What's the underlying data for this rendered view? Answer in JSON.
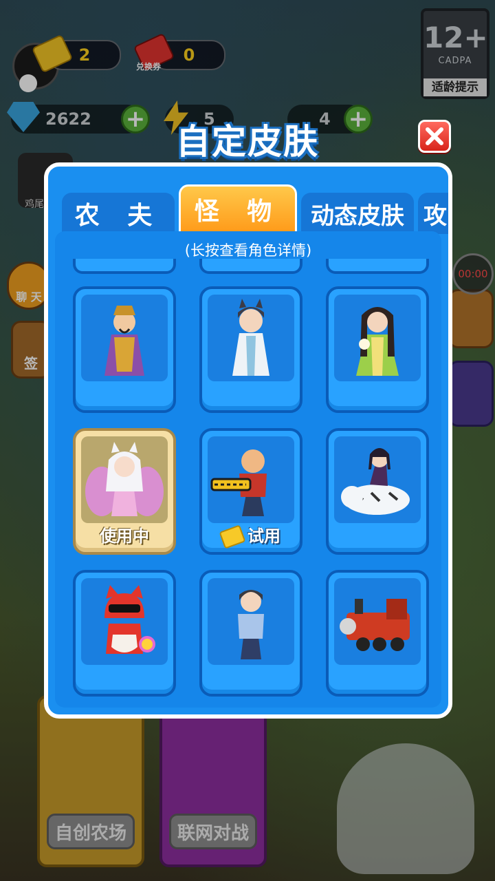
{
  "header": {
    "voucher_gold": {
      "count": "2"
    },
    "voucher_red": {
      "count": "0",
      "label": "兑换券"
    },
    "gems": "2622",
    "energy": "5",
    "potion": "4",
    "side_label_chicken": "鸡尾",
    "side_label_chat": "聊 天",
    "side_label_sign": "签"
  },
  "age_rating": {
    "age": "12+",
    "org": "CADPA",
    "tip": "适龄提示"
  },
  "timer": "00:00",
  "bottom_cards": {
    "create_farm": "自创农场",
    "online_battle": "联网对战"
  },
  "dialog": {
    "title": "自定皮肤",
    "hint": "(长按查看角色详情)",
    "tabs": [
      {
        "label": "农 夫",
        "active": false
      },
      {
        "label": "怪 物",
        "active": true
      },
      {
        "label": "动态皮肤",
        "active": false
      },
      {
        "label": "攻",
        "active": false
      }
    ],
    "skins": [
      {
        "icon": "emperor-icon",
        "caption": ""
      },
      {
        "icon": "white-robe-cat-girl-icon",
        "caption": ""
      },
      {
        "icon": "green-dress-lady-icon",
        "caption": ""
      },
      {
        "icon": "nine-tail-fox-girl-icon",
        "caption": "使用中",
        "selected": true
      },
      {
        "icon": "chainsaw-man-icon",
        "caption": "试用",
        "trial": true
      },
      {
        "icon": "cat-girl-on-tiger-icon",
        "caption": ""
      },
      {
        "icon": "red-cat-sunglasses-icon",
        "caption": ""
      },
      {
        "icon": "grey-hair-boy-icon",
        "caption": ""
      },
      {
        "icon": "red-train-icon",
        "caption": ""
      }
    ]
  },
  "colors": {
    "panel": "#1a8ff0",
    "tab_active": "#ff9b1a",
    "card": "#29a2ff",
    "selected": "#f6dfa5"
  }
}
